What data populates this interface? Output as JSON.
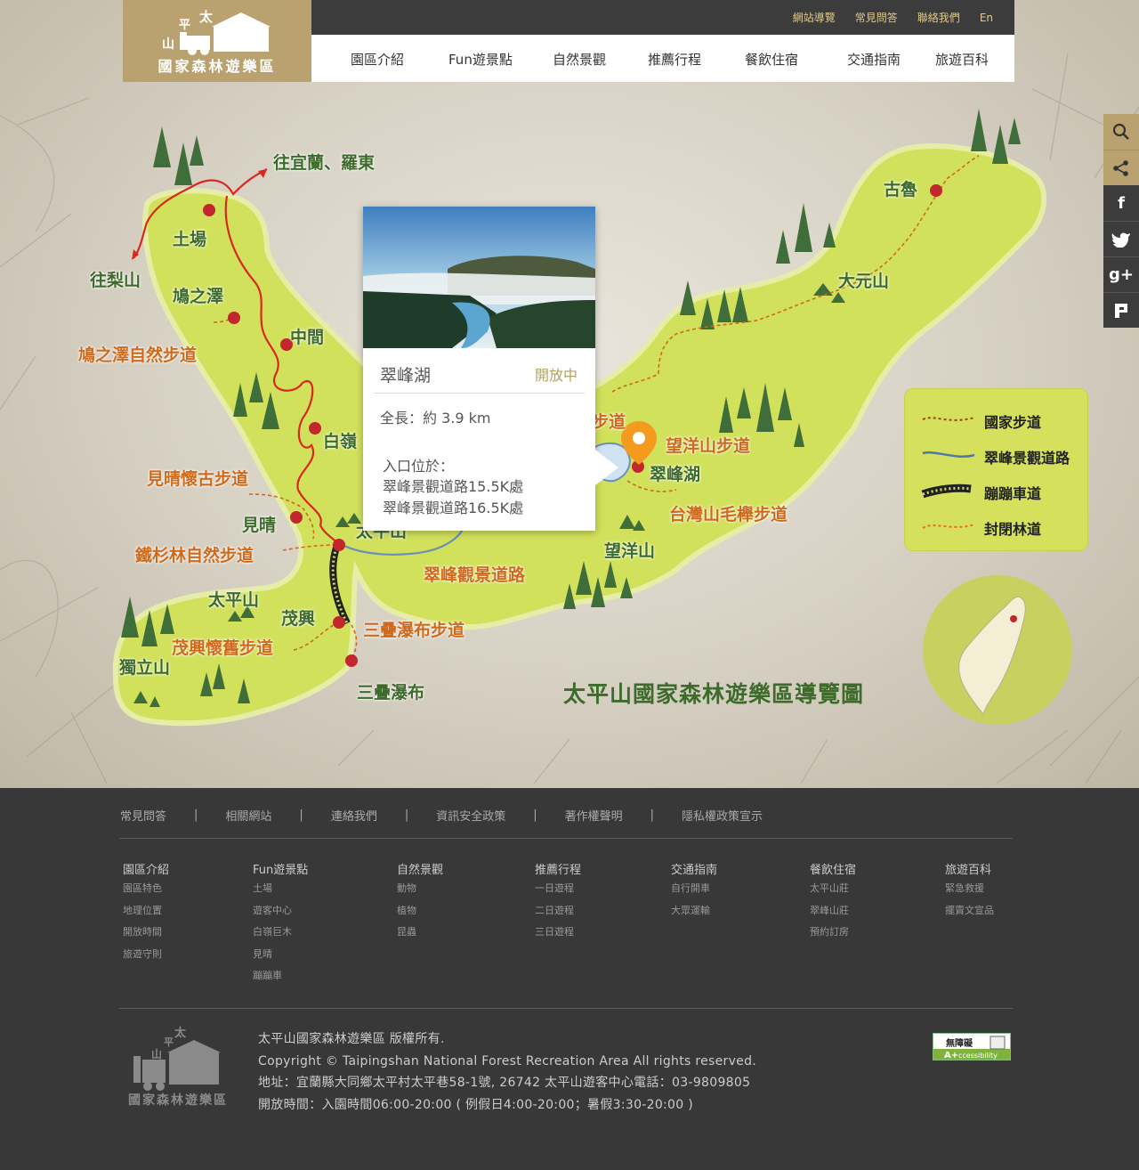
{
  "logo": {
    "alt": "太平山國家森林遊樂區",
    "line1": "太",
    "line2": "平",
    "line3": "山",
    "name": "國家森林遊樂區"
  },
  "topbar": {
    "links": [
      "網站導覽",
      "常見問答",
      "聯絡我們",
      "En"
    ]
  },
  "nav": [
    "園區介紹",
    "Fun遊景點",
    "自然景觀",
    "推薦行程",
    "餐飲住宿",
    "交通指南",
    "旅遊百科"
  ],
  "side": [
    "search-icon",
    "share-icon",
    "facebook-icon",
    "twitter-icon",
    "googleplus-icon",
    "plurk-icon"
  ],
  "map": {
    "labels_green": [
      "往宜蘭、羅東",
      "土場",
      "往梨山",
      "鳩之澤",
      "中間",
      "白嶺",
      "見晴",
      "太平山",
      "茂興",
      "獨立山",
      "三疊瀑布",
      "古魯",
      "大元山",
      "翠峰湖",
      "望洋山",
      "太平山"
    ],
    "labels_orange": [
      "鳩之澤自然步道",
      "見晴懷古步道",
      "鐵杉林自然步道",
      "茂興懷舊步道",
      "三疊瀑布步道",
      "翠峰觀景道路",
      "望洋山步道",
      "台灣山毛櫸步道",
      "步道"
    ],
    "title": "太平山國家森林遊樂區導覽圖"
  },
  "popup": {
    "title": "翠峰湖",
    "status": "開放中",
    "length": "全長：約 3.9 km",
    "entrance_label": "入口位於：",
    "entrance_1": "翠峰景觀道路15.5K處",
    "entrance_2": "翠峰景觀道路16.5K處"
  },
  "legend": [
    "國家步道",
    "翠峰景觀道路",
    "蹦蹦車道",
    "封閉林道"
  ],
  "footer": {
    "links": [
      "常見問答",
      "相關網站",
      "連絡我們",
      "資訊安全政策",
      "著作權聲明",
      "隱私權政策宣示"
    ],
    "cols": [
      {
        "title": "園區介紹",
        "items": [
          "園區特色",
          "地理位置",
          "開放時間",
          "旅遊守則"
        ]
      },
      {
        "title": "Fun遊景點",
        "items": [
          "土場",
          "遊客中心",
          "白嶺巨木",
          "見晴",
          "蹦蹦車"
        ]
      },
      {
        "title": "自然景觀",
        "items": [
          "動物",
          "植物",
          "昆蟲"
        ]
      },
      {
        "title": "推薦行程",
        "items": [
          "一日遊程",
          "二日遊程",
          "三日遊程"
        ]
      },
      {
        "title": "交通指南",
        "items": [
          "自行開車",
          "大眾運輸"
        ]
      },
      {
        "title": "餐飲住宿",
        "items": [
          "太平山莊",
          "翠峰山莊",
          "預約訂房"
        ]
      },
      {
        "title": "旅遊百科",
        "items": [
          "緊急救援",
          "擺賣文宣品"
        ]
      }
    ],
    "copyright_1": "太平山國家森林遊樂區  版權所有.",
    "copyright_2": "Copyright © Taipingshan National Forest Recreation Area All rights reserved.",
    "address": "地址：宜蘭縣大同鄉太平村太平巷58-1號, 26742   太平山遊客中心電話：03-9809805",
    "hours": "開放時間：入園時間06:00-20:00 ( 例假日4:00-20:00；暑假3:30-20:00 )",
    "accessibility": "無障礙 A+ccessibility"
  }
}
